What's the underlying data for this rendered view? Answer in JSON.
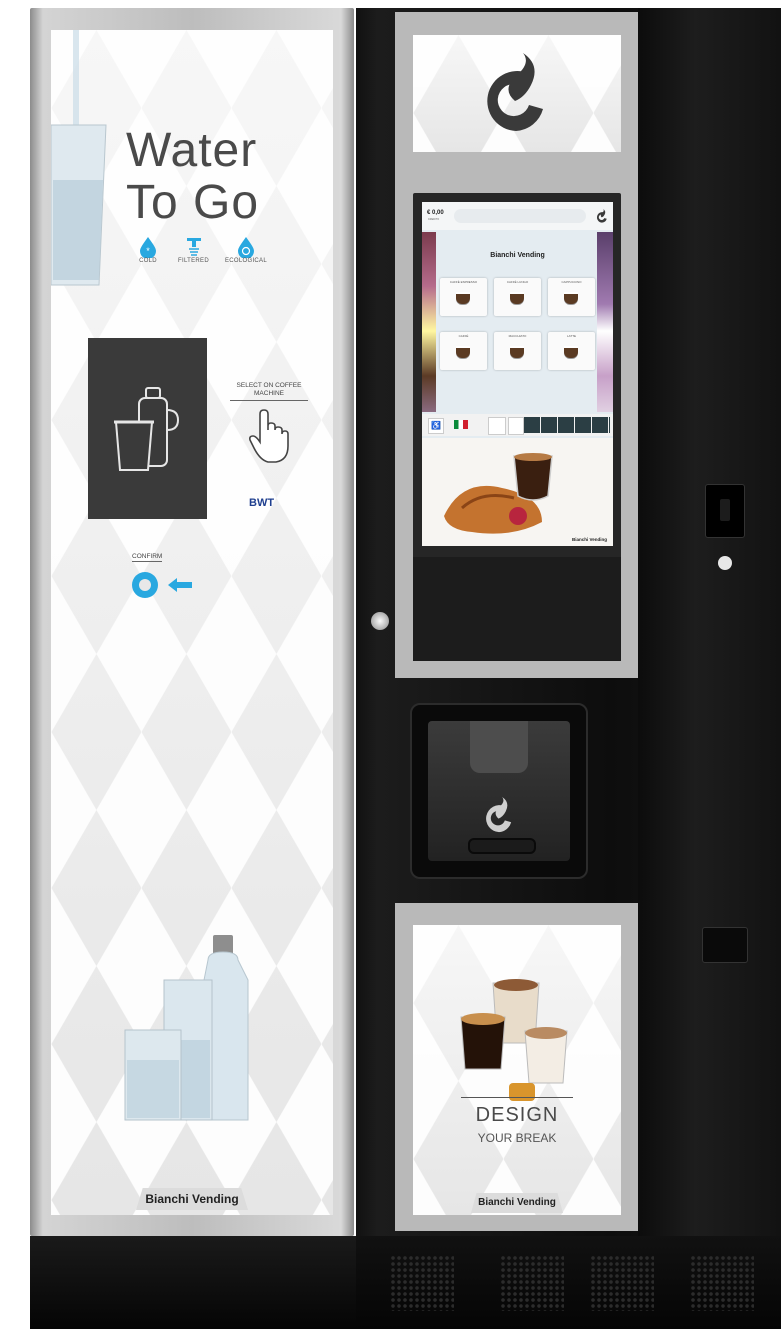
{
  "water_panel": {
    "title_line1": "Water",
    "title_line2": "To Go",
    "features": [
      {
        "label": "COLD",
        "icon": "snowflake-drop-icon"
      },
      {
        "label": "FILTERED",
        "icon": "filter-tap-icon"
      },
      {
        "label": "ECOLOGICAL",
        "icon": "recycle-drop-icon"
      }
    ],
    "select_instruction": "SELECT ON COFFEE MACHINE",
    "bwt_logo": "BWT",
    "confirm_label": "CONFIRM",
    "brand": "Bianchi Vending"
  },
  "screen": {
    "credit": "€ 0,00",
    "credit_sub": "CREDITO",
    "brand": "Bianchi Vending",
    "ad_brand": "Bianchi Vending",
    "products": [
      "CAFFÈ ESPRESSO",
      "CAFFÈ LUNGO",
      "CAPPUCCINO",
      "CAFFÈ",
      "MACCHIATO",
      "LATTE"
    ]
  },
  "bottom_panel": {
    "headline": "DESIGN",
    "subline": "YOUR BREAK",
    "brand": "Bianchi Vending"
  },
  "colors": {
    "accent_blue": "#29a8e0",
    "cabinet_black": "#111111",
    "frame_silver": "#b9b9b9"
  }
}
